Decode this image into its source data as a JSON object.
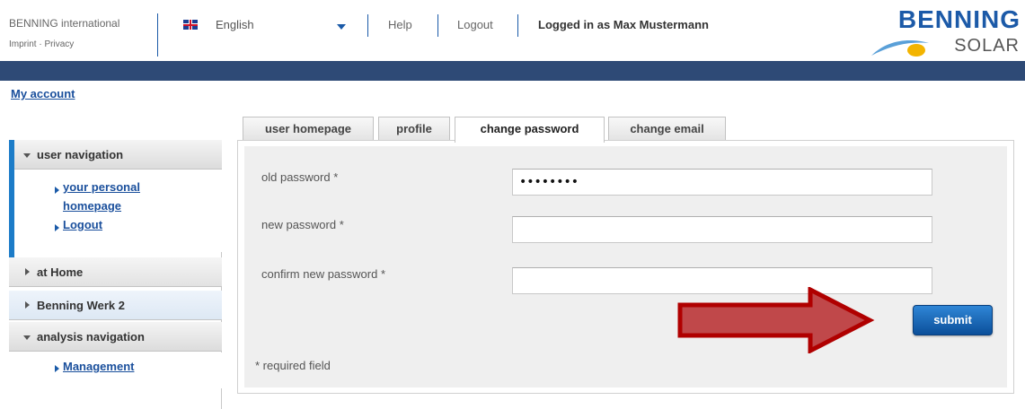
{
  "header": {
    "brand_text": "BENNING international",
    "imprint_label": "Imprint",
    "link_separator": "·",
    "privacy_label": "Privacy",
    "language": "English",
    "help_label": "Help",
    "logout_label": "Logout",
    "logged_in_text": "Logged in as Max Mustermann",
    "logo_top": "BENNING",
    "logo_bottom": "SOLAR"
  },
  "breadcrumb": {
    "my_account_label": "My account"
  },
  "sidebar": {
    "user_nav_title": "user navigation",
    "user_links": [
      "your personal",
      "homepage",
      "Logout"
    ],
    "at_home_label": "at Home",
    "werk_label": "Benning Werk 2",
    "analysis_nav_title": "analysis navigation",
    "management_label": "Management"
  },
  "tabs": [
    {
      "label": "user homepage",
      "active": false
    },
    {
      "label": "profile",
      "active": false
    },
    {
      "label": "change password",
      "active": true
    },
    {
      "label": "change email",
      "active": false
    }
  ],
  "form": {
    "old_password_label": "old password *",
    "old_password_value": "••••••••",
    "new_password_label": "new password *",
    "new_password_value": "",
    "confirm_password_label": "confirm new password *",
    "confirm_password_value": "",
    "submit_label": "submit",
    "required_note": "* required field"
  },
  "colors": {
    "navbar": "#2e4a76",
    "link": "#1a4f9c",
    "accent": "#1c7cc8",
    "submit": "#0b4f9a",
    "arrow": "#c0484a"
  }
}
